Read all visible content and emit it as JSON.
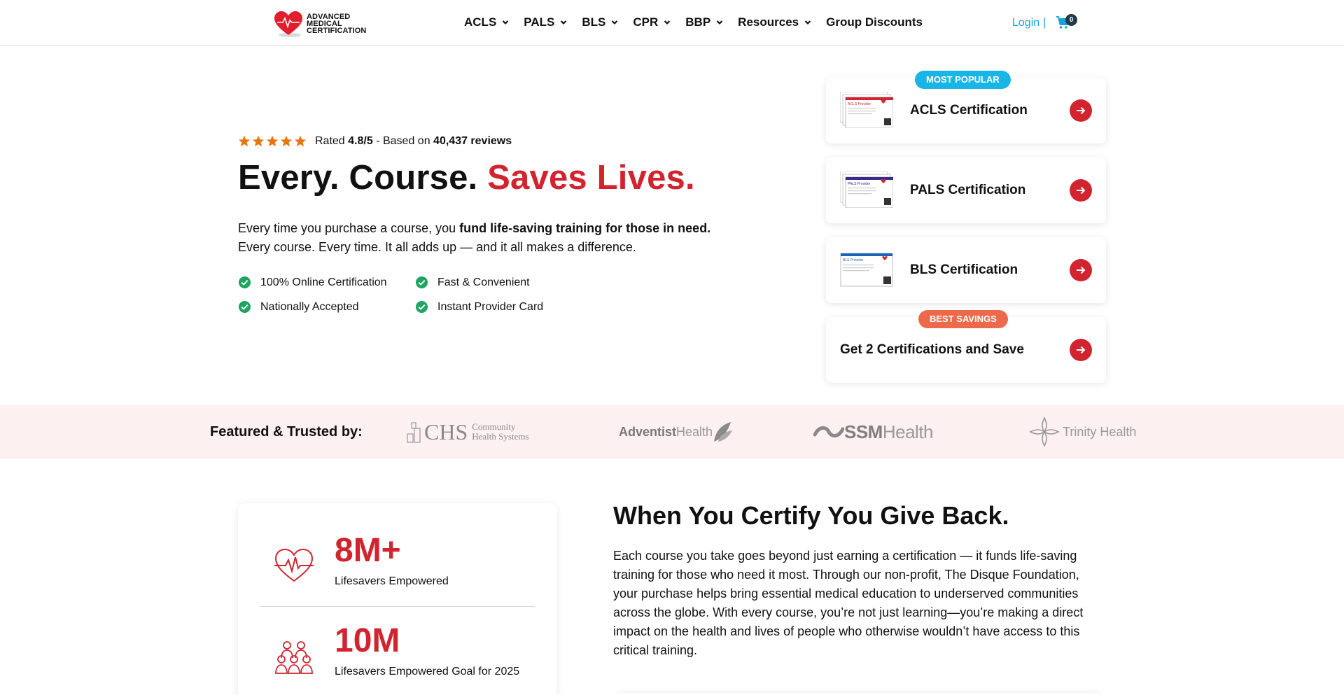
{
  "header": {
    "logo_lines": [
      "ADVANCED",
      "MEDICAL",
      "CERTIFICATION"
    ],
    "nav": [
      {
        "label": "ACLS",
        "has_dropdown": true
      },
      {
        "label": "PALS",
        "has_dropdown": true
      },
      {
        "label": "BLS",
        "has_dropdown": true
      },
      {
        "label": "CPR",
        "has_dropdown": true
      },
      {
        "label": "BBP",
        "has_dropdown": true
      },
      {
        "label": "Resources",
        "has_dropdown": true
      },
      {
        "label": "Group Discounts",
        "has_dropdown": false
      }
    ],
    "login_label": "Login",
    "separator": "|",
    "cart_count": "0",
    "cart_icon": "shopping-cart-icon"
  },
  "hero": {
    "rating_prefix": "Rated",
    "rating_value": "4.8/5",
    "rating_middle": "- Based on",
    "review_count": "40,437 reviews",
    "stars": 5,
    "headline_plain": "Every. Course.",
    "headline_accent": "Saves Lives.",
    "intro_line1_plain": "Every time you purchase a course, you",
    "intro_line1_bold": "fund life-saving training for those in need.",
    "intro_line2": "Every course. Every time. It all adds up — and it all makes a difference.",
    "features": [
      "100% Online Certification",
      "Fast & Convenient",
      "Nationally Accepted",
      "Instant Provider Card"
    ]
  },
  "cards": [
    {
      "title": "ACLS Certification",
      "badge": "MOST POPULAR",
      "thumb_caption": "ACLS Provider",
      "thumb_header": "ADVANCED CARDIAC LIFE SUPPORT"
    },
    {
      "title": "PALS Certification",
      "badge": "",
      "thumb_caption": "PALS Provider",
      "thumb_header": "PEDIATRIC ADVANCED LIFE SUPPORT"
    },
    {
      "title": "BLS Certification",
      "badge": "",
      "thumb_caption": "BLS Provider",
      "thumb_header": "BASIC LIFE SUPPORT"
    },
    {
      "title": "Get 2 Certifications and Save",
      "badge": "BEST SAVINGS"
    }
  ],
  "trusted": {
    "label": "Featured & Trusted by:",
    "brands": [
      {
        "name": "CHS",
        "sub1": "Community",
        "sub2": "Health Systems"
      },
      {
        "name": "Adventist",
        "name2": "Health"
      },
      {
        "name": "SSM",
        "name2": "Health"
      },
      {
        "name": "Trinity Health"
      }
    ]
  },
  "stats": [
    {
      "value": "8M+",
      "label": "Lifesavers Empowered",
      "icon": "heartbeat-icon"
    },
    {
      "value": "10M",
      "label": "Lifesavers Empowered Goal for 2025",
      "icon": "people-group-icon"
    }
  ],
  "give_back": {
    "title": "When You Certify You Give Back.",
    "text": "Each course you take goes beyond just earning a certification — it funds life-saving training for those who need it most. Through our non-profit, The Disque Foundation, your purchase helps bring essential medical education to underserved communities across the globe. With every course, you’re not just learning—you’re making a direct impact on the health and lives of people who otherwise wouldn’t have access to this critical training."
  },
  "colors": {
    "brand_red": "#d1242f",
    "link_blue": "#1aa3d8",
    "popular_badge": "#19b5e6",
    "savings_badge": "#ec6a4b",
    "check_green": "#1fa463",
    "star_orange": "#e8760f",
    "trusted_bg": "#fdf0f0"
  }
}
